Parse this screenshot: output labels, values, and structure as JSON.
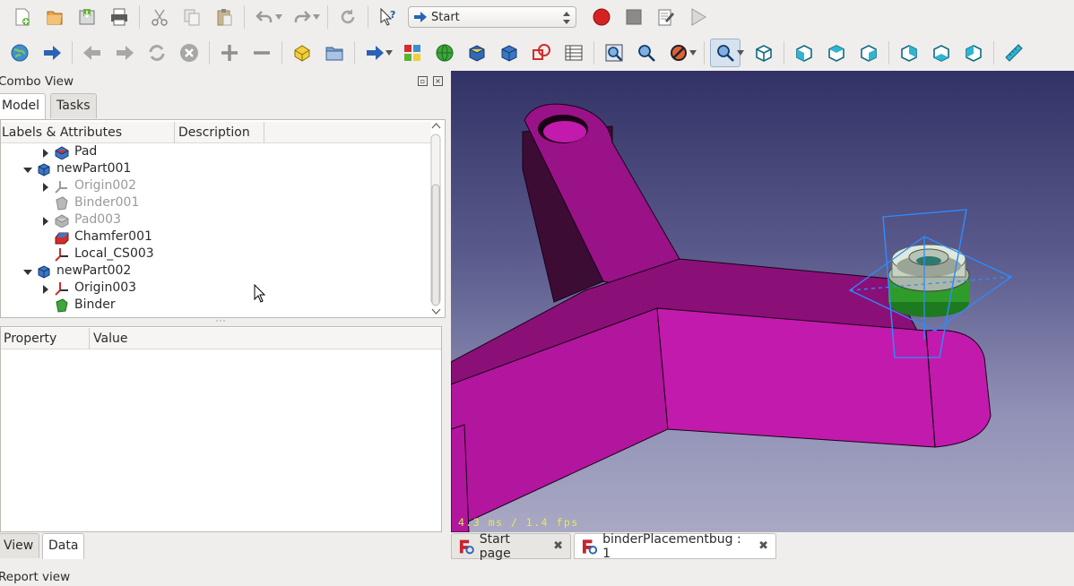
{
  "toolbar1": {
    "workbench": {
      "selected": "Start"
    }
  },
  "combo": {
    "title": "Combo View",
    "tabs": [
      "Model",
      "Tasks"
    ],
    "tree": {
      "columns": [
        "Labels & Attributes",
        "Description"
      ],
      "rows": [
        {
          "label": "Pad"
        },
        {
          "label": "newPart001"
        },
        {
          "label": "Origin002"
        },
        {
          "label": "Binder001"
        },
        {
          "label": "Pad003"
        },
        {
          "label": "Chamfer001"
        },
        {
          "label": "Local_CS003"
        },
        {
          "label": "newPart002"
        },
        {
          "label": "Origin003"
        },
        {
          "label": "Binder"
        }
      ]
    },
    "property": {
      "columns": [
        "Property",
        "Value"
      ],
      "tabs": [
        "View",
        "Data"
      ]
    }
  },
  "viewport": {
    "fps_text": "4.3 ms / 1.4 fps",
    "colors": {
      "part": "#b2159e",
      "part_dark": "#3d0c35",
      "gear": "#c7d2c3",
      "gear_green": "#2e9b2a",
      "gizmo": "#2d8cff"
    }
  },
  "doc_tabs": [
    {
      "label": "Start page"
    },
    {
      "label": "binderPlacementbug : 1"
    }
  ],
  "report": {
    "title": "Report view"
  }
}
